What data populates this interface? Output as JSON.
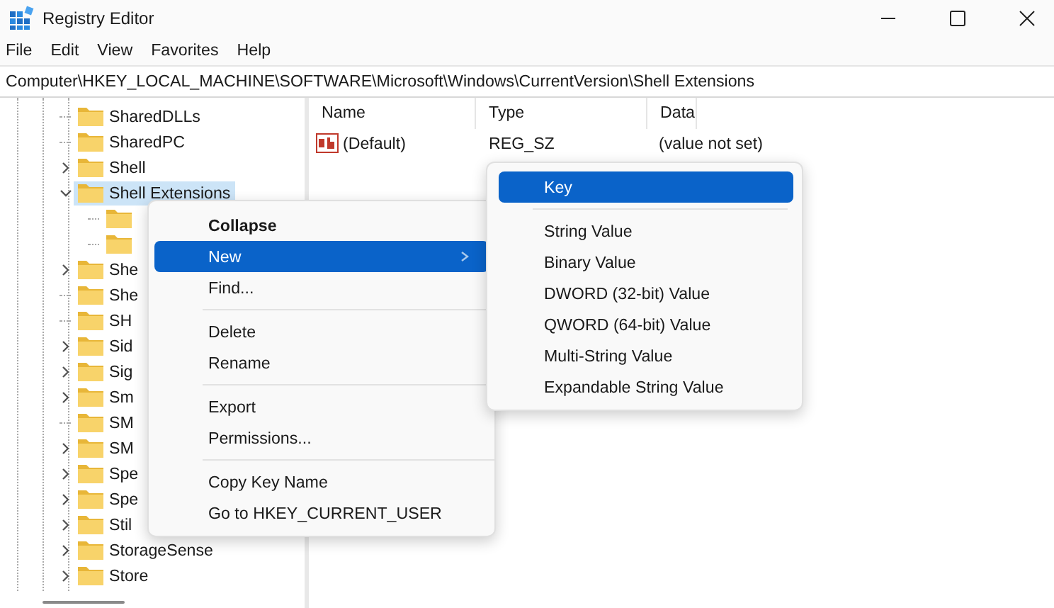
{
  "window": {
    "title": "Registry Editor"
  },
  "menu_bar": [
    "File",
    "Edit",
    "View",
    "Favorites",
    "Help"
  ],
  "address": "Computer\\HKEY_LOCAL_MACHINE\\SOFTWARE\\Microsoft\\Windows\\CurrentVersion\\Shell Extensions",
  "tree": [
    {
      "name": "SharedDLLs",
      "expandable": false,
      "expanded": false,
      "selected": false
    },
    {
      "name": "SharedPC",
      "expandable": false,
      "expanded": false,
      "selected": false
    },
    {
      "name": "Shell",
      "expandable": true,
      "expanded": false,
      "selected": false
    },
    {
      "name": "Shell Extensions",
      "expandable": true,
      "expanded": true,
      "selected": true,
      "children": [
        {
          "expandable": false,
          "expanded": false,
          "selected": false
        },
        {
          "expandable": false,
          "expanded": false,
          "selected": false
        }
      ]
    },
    {
      "name": "She",
      "expandable": true,
      "expanded": false,
      "selected": false
    },
    {
      "name": "She",
      "expandable": false,
      "expanded": false,
      "selected": false
    },
    {
      "name": "SH",
      "expandable": false,
      "expanded": false,
      "selected": false
    },
    {
      "name": "Sid",
      "expandable": true,
      "expanded": false,
      "selected": false
    },
    {
      "name": "Sig",
      "expandable": true,
      "expanded": false,
      "selected": false
    },
    {
      "name": "Sm",
      "expandable": true,
      "expanded": false,
      "selected": false
    },
    {
      "name": "SM",
      "expandable": false,
      "expanded": false,
      "selected": false
    },
    {
      "name": "SM",
      "expandable": true,
      "expanded": false,
      "selected": false
    },
    {
      "name": "Spe",
      "expandable": true,
      "expanded": false,
      "selected": false
    },
    {
      "name": "Spe",
      "expandable": true,
      "expanded": false,
      "selected": false
    },
    {
      "name": "Stil",
      "expandable": true,
      "expanded": false,
      "selected": false
    },
    {
      "name": "StorageSense",
      "expandable": true,
      "expanded": false,
      "selected": false
    },
    {
      "name": "Store",
      "expandable": true,
      "expanded": false,
      "selected": false
    }
  ],
  "values_table": {
    "columns": [
      "Name",
      "Type",
      "Data"
    ],
    "rows": [
      {
        "name": "(Default)",
        "type": "REG_SZ",
        "data": "(value not set)"
      }
    ]
  },
  "context_menu": [
    {
      "kind": "item",
      "label": "Collapse",
      "bold": true,
      "selected": false
    },
    {
      "kind": "item",
      "label": "New",
      "bold": false,
      "selected": true,
      "submenu": true
    },
    {
      "kind": "item",
      "label": "Find...",
      "bold": false,
      "selected": false
    },
    {
      "kind": "separator"
    },
    {
      "kind": "item",
      "label": "Delete",
      "bold": false,
      "selected": false
    },
    {
      "kind": "item",
      "label": "Rename",
      "bold": false,
      "selected": false
    },
    {
      "kind": "separator"
    },
    {
      "kind": "item",
      "label": "Export",
      "bold": false,
      "selected": false
    },
    {
      "kind": "item",
      "label": "Permissions...",
      "bold": false,
      "selected": false
    },
    {
      "kind": "separator"
    },
    {
      "kind": "item",
      "label": "Copy Key Name",
      "bold": false,
      "selected": false
    },
    {
      "kind": "item",
      "label": "Go to HKEY_CURRENT_USER",
      "bold": false,
      "selected": false
    }
  ],
  "submenu": [
    {
      "kind": "item",
      "label": "Key",
      "selected": true
    },
    {
      "kind": "separator"
    },
    {
      "kind": "item",
      "label": "String Value",
      "selected": false
    },
    {
      "kind": "item",
      "label": "Binary Value",
      "selected": false
    },
    {
      "kind": "item",
      "label": "DWORD (32-bit) Value",
      "selected": false
    },
    {
      "kind": "item",
      "label": "QWORD (64-bit) Value",
      "selected": false
    },
    {
      "kind": "item",
      "label": "Multi-String Value",
      "selected": false
    },
    {
      "kind": "item",
      "label": "Expandable String Value",
      "selected": false
    }
  ]
}
